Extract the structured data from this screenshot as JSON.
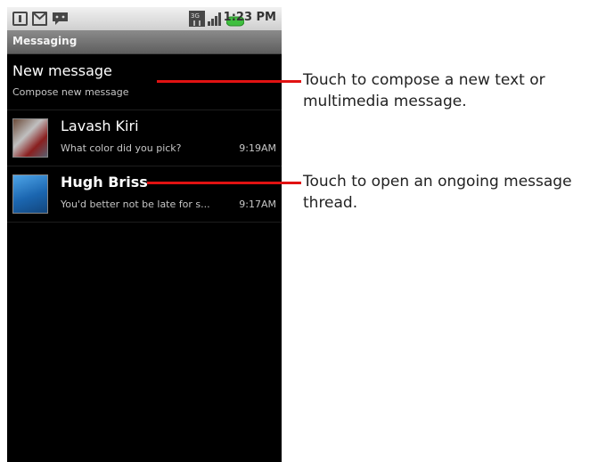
{
  "status_bar": {
    "time": "1:23 PM",
    "icons": [
      "sim-icon",
      "gmail-icon",
      "chat-icon",
      "3g-icon",
      "signal-icon",
      "battery-icon"
    ]
  },
  "app": {
    "title": "Messaging"
  },
  "new_message": {
    "title": "New message",
    "subtitle": "Compose new message"
  },
  "threads": [
    {
      "contact": "Lavash Kiri",
      "snippet": "What color did you pick?",
      "time": "9:19AM",
      "unread": false
    },
    {
      "contact": "Hugh Briss",
      "snippet": "You'd better not be late for s...",
      "time": "9:17AM",
      "unread": true
    }
  ],
  "annotations": {
    "compose": "Touch to compose a new text or multimedia message.",
    "thread": "Touch to open an ongoing message thread."
  },
  "colors": {
    "callout_line": "#e11212",
    "screen_bg": "#000000"
  }
}
